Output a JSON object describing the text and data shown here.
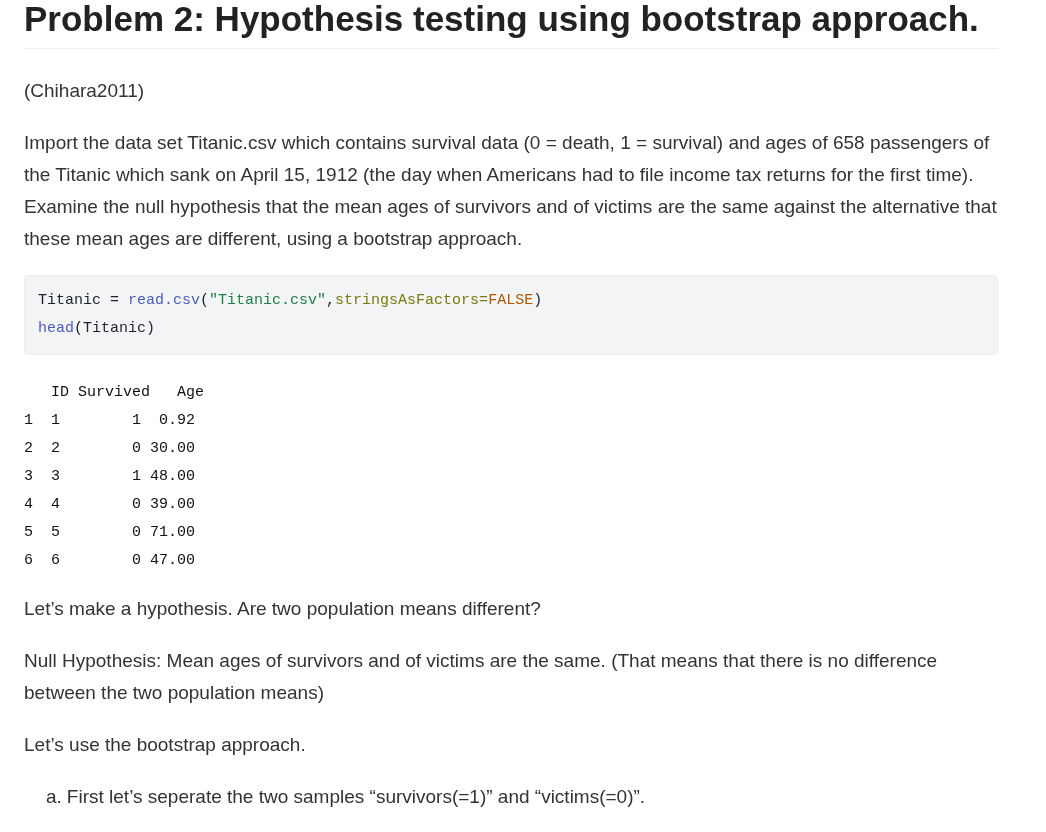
{
  "title": "Problem 2: Hypothesis testing using bootstrap approach.",
  "citation": "(Chihara2011)",
  "intro": "Import the data set Titanic.csv which contains survival data (0 = death, 1 = survival) and ages of 658 passengers of the Titanic which sank on April 15, 1912 (the day when Americans had to file income tax returns for the first time). Examine the null hypothesis that the mean ages of survivors and of victims are the same against the alternative that these mean ages are different, using a bootstrap approach.",
  "code_lines": [
    [
      {
        "kind": "plain",
        "text": "Titanic = "
      },
      {
        "kind": "function",
        "text": "read.csv"
      },
      {
        "kind": "plain",
        "text": "("
      },
      {
        "kind": "string",
        "text": "\"Titanic.csv\""
      },
      {
        "kind": "plain",
        "text": ","
      },
      {
        "kind": "argument",
        "text": "stringsAsFactors="
      },
      {
        "kind": "constant",
        "text": "FALSE"
      },
      {
        "kind": "plain",
        "text": ")"
      }
    ],
    [
      {
        "kind": "function",
        "text": "head"
      },
      {
        "kind": "plain",
        "text": "(Titanic)"
      }
    ]
  ],
  "output_lines": [
    "   ID Survived   Age",
    "1  1        1  0.92",
    "2  2        0 30.00",
    "3  3        1 48.00",
    "4  4        0 39.00",
    "5  5        0 71.00",
    "6  6        0 47.00"
  ],
  "paragraphs": [
    "Let’s make a hypothesis. Are two population means different?",
    "Null Hypothesis: Mean ages of survivors and of victims are the same. (That means that there is no difference between the two population means)",
    "Let’s use the bootstrap approach."
  ],
  "list_items": [
    {
      "marker": "a.",
      "text": "First let’s seperate the two samples “survivors(=1)” and “victims(=0)”."
    }
  ]
}
